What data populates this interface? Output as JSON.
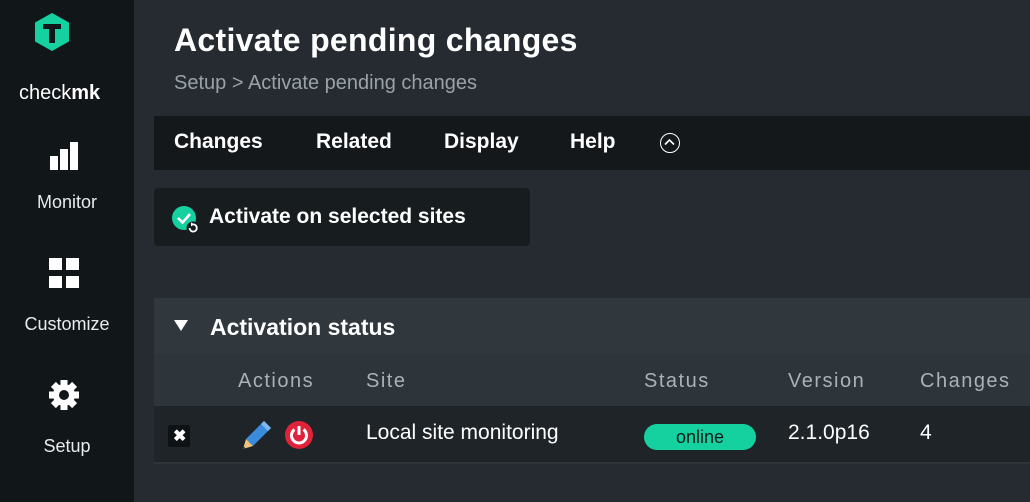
{
  "app": {
    "logo_prefix": "check",
    "logo_bold": "mk"
  },
  "sidebar": {
    "items": [
      {
        "label": "Monitor",
        "icon": "bar-chart-icon"
      },
      {
        "label": "Customize",
        "icon": "grid-icon"
      },
      {
        "label": "Setup",
        "icon": "gear-icon"
      }
    ]
  },
  "page": {
    "title": "Activate pending changes",
    "breadcrumb": "Setup > Activate pending changes"
  },
  "menu": {
    "items": [
      "Changes",
      "Related",
      "Display",
      "Help"
    ],
    "collapse_icon": "chevron-up-circle-icon"
  },
  "toolbar": {
    "activate_label": "Activate on selected sites"
  },
  "activation": {
    "title": "Activation status",
    "headers": [
      "Actions",
      "Site",
      "Status",
      "Version",
      "Changes"
    ],
    "rows": [
      {
        "site": "Local site monitoring",
        "status": "online",
        "version": "2.1.0p16",
        "changes": "4"
      }
    ]
  },
  "colors": {
    "sidebar_bg": "#111619",
    "main_bg": "#252b31",
    "accent_green": "#15d1a0",
    "danger_red": "#e0223a"
  }
}
